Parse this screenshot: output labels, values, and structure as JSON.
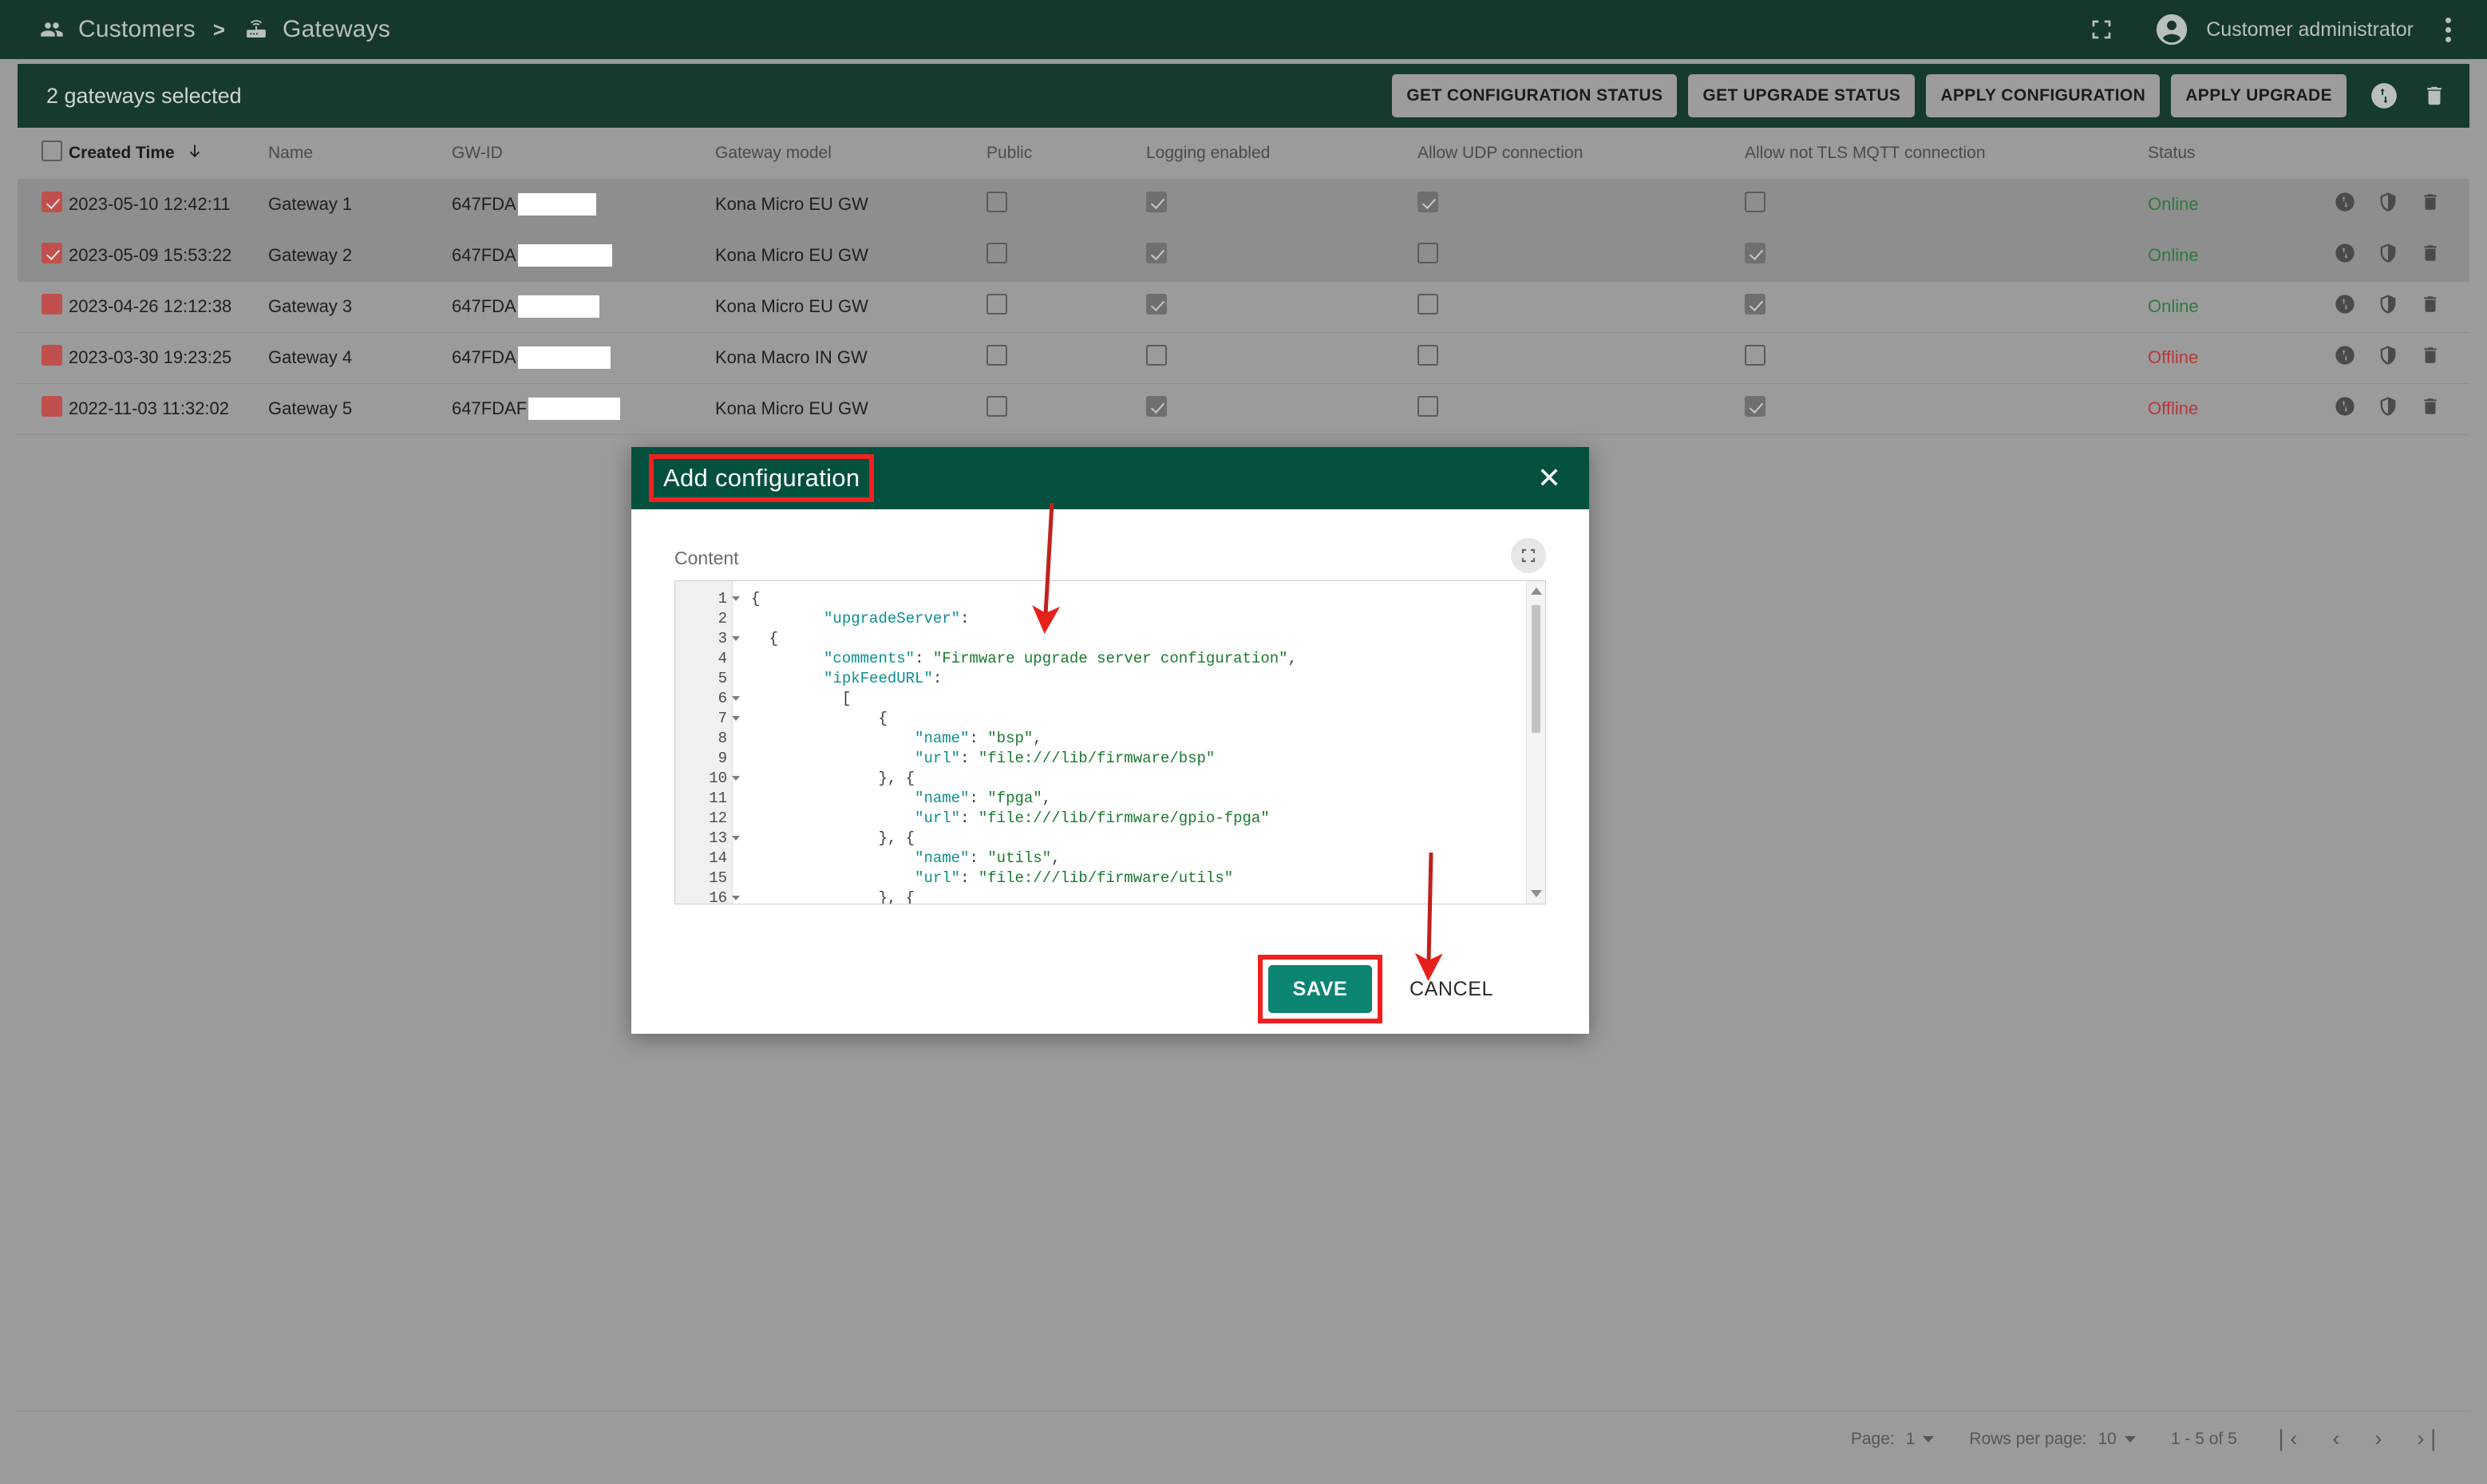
{
  "topbar": {
    "breadcrumb": [
      {
        "label": "Customers",
        "icon": "people-icon"
      },
      {
        "label": "Gateways",
        "icon": "router-wifi-icon"
      }
    ],
    "separator": ">",
    "user_name": "Customer administrator",
    "fullscreen_icon": "fullscreen-icon",
    "avatar_icon": "account-circle-icon",
    "menu_icon": "kebab-menu-icon"
  },
  "selection_toolbar": {
    "label": "2 gateways selected",
    "buttons": [
      "GET CONFIGURATION STATUS",
      "GET UPGRADE STATUS",
      "APPLY CONFIGURATION",
      "APPLY UPGRADE"
    ],
    "upgrade_icon": "up-down-arrows-icon",
    "delete_icon": "trash-icon"
  },
  "table": {
    "columns": [
      "Created Time",
      "Name",
      "GW-ID",
      "Gateway model",
      "Public",
      "Logging enabled",
      "Allow UDP connection",
      "Allow not TLS MQTT connection",
      "Status"
    ],
    "sort_column": "Created Time",
    "sort_direction": "desc",
    "rows": [
      {
        "selected": true,
        "created_time": "2023-05-10 12:42:11",
        "name": "Gateway 1",
        "gw_id_prefix": "647FDA",
        "gw_id_redacted_width": 98,
        "model": "Kona Micro EU GW",
        "public": false,
        "logging_enabled": true,
        "allow_udp": true,
        "allow_not_tls_mqtt": false,
        "status": "Online"
      },
      {
        "selected": true,
        "created_time": "2023-05-09 15:53:22",
        "name": "Gateway 2",
        "gw_id_prefix": "647FDA",
        "gw_id_redacted_width": 118,
        "model": "Kona Micro EU GW",
        "public": false,
        "logging_enabled": true,
        "allow_udp": false,
        "allow_not_tls_mqtt": true,
        "status": "Online"
      },
      {
        "selected": false,
        "created_time": "2023-04-26 12:12:38",
        "name": "Gateway 3",
        "gw_id_prefix": "647FDA",
        "gw_id_redacted_width": 102,
        "model": "Kona Micro EU GW",
        "public": false,
        "logging_enabled": true,
        "allow_udp": false,
        "allow_not_tls_mqtt": true,
        "status": "Online"
      },
      {
        "selected": false,
        "created_time": "2023-03-30 19:23:25",
        "name": "Gateway 4",
        "gw_id_prefix": "647FDA",
        "gw_id_redacted_width": 116,
        "model": "Kona Macro IN GW",
        "public": false,
        "logging_enabled": false,
        "allow_udp": false,
        "allow_not_tls_mqtt": false,
        "status": "Offline"
      },
      {
        "selected": false,
        "created_time": "2022-11-03 11:32:02",
        "name": "Gateway 5",
        "gw_id_prefix": "647FDAF",
        "gw_id_redacted_width": 115,
        "model": "Kona Micro EU GW",
        "public": false,
        "logging_enabled": true,
        "allow_udp": false,
        "allow_not_tls_mqtt": true,
        "status": "Offline"
      }
    ],
    "row_action_icons": [
      "upgrade-icon",
      "shield-icon",
      "trash-icon"
    ]
  },
  "pagination": {
    "page_label": "Page:",
    "page_value": "1",
    "rows_label": "Rows per page:",
    "rows_value": "10",
    "range": "1 - 5 of 5",
    "first_icon": "first-page-icon",
    "prev_icon": "prev-page-icon",
    "next_icon": "next-page-icon",
    "last_icon": "last-page-icon"
  },
  "modal": {
    "title": "Add configuration",
    "close_icon": "close-icon",
    "content_label": "Content",
    "expand_icon": "fullscreen-expand-icon",
    "save_label": "SAVE",
    "cancel_label": "CANCEL",
    "editor": {
      "lines": [
        {
          "n": "1",
          "fold": true,
          "indent": 0,
          "tokens": [
            {
              "t": "pun",
              "v": "{"
            }
          ]
        },
        {
          "n": "2",
          "fold": false,
          "indent": 4,
          "tokens": [
            {
              "t": "key",
              "v": "\"upgradeServer\""
            },
            {
              "t": "pun",
              "v": ":"
            }
          ]
        },
        {
          "n": "3",
          "fold": true,
          "indent": 1,
          "tokens": [
            {
              "t": "pun",
              "v": "{"
            }
          ]
        },
        {
          "n": "4",
          "fold": false,
          "indent": 4,
          "tokens": [
            {
              "t": "key",
              "v": "\"comments\""
            },
            {
              "t": "pun",
              "v": ": "
            },
            {
              "t": "str",
              "v": "\"Firmware upgrade server configuration\""
            },
            {
              "t": "pun",
              "v": ","
            }
          ]
        },
        {
          "n": "5",
          "fold": false,
          "indent": 4,
          "tokens": [
            {
              "t": "key",
              "v": "\"ipkFeedURL\""
            },
            {
              "t": "pun",
              "v": ":"
            }
          ]
        },
        {
          "n": "6",
          "fold": true,
          "indent": 5,
          "tokens": [
            {
              "t": "pun",
              "v": "["
            }
          ]
        },
        {
          "n": "7",
          "fold": true,
          "indent": 7,
          "tokens": [
            {
              "t": "pun",
              "v": "{"
            }
          ]
        },
        {
          "n": "8",
          "fold": false,
          "indent": 9,
          "tokens": [
            {
              "t": "key",
              "v": "\"name\""
            },
            {
              "t": "pun",
              "v": ": "
            },
            {
              "t": "str",
              "v": "\"bsp\""
            },
            {
              "t": "pun",
              "v": ","
            }
          ]
        },
        {
          "n": "9",
          "fold": false,
          "indent": 9,
          "tokens": [
            {
              "t": "key",
              "v": "\"url\""
            },
            {
              "t": "pun",
              "v": ": "
            },
            {
              "t": "str",
              "v": "\"file:///lib/firmware/bsp\""
            }
          ]
        },
        {
          "n": "10",
          "fold": true,
          "indent": 7,
          "tokens": [
            {
              "t": "pun",
              "v": "}, {"
            }
          ]
        },
        {
          "n": "11",
          "fold": false,
          "indent": 9,
          "tokens": [
            {
              "t": "key",
              "v": "\"name\""
            },
            {
              "t": "pun",
              "v": ": "
            },
            {
              "t": "str",
              "v": "\"fpga\""
            },
            {
              "t": "pun",
              "v": ","
            }
          ]
        },
        {
          "n": "12",
          "fold": false,
          "indent": 9,
          "tokens": [
            {
              "t": "key",
              "v": "\"url\""
            },
            {
              "t": "pun",
              "v": ": "
            },
            {
              "t": "str",
              "v": "\"file:///lib/firmware/gpio-fpga\""
            }
          ]
        },
        {
          "n": "13",
          "fold": true,
          "indent": 7,
          "tokens": [
            {
              "t": "pun",
              "v": "}, {"
            }
          ]
        },
        {
          "n": "14",
          "fold": false,
          "indent": 9,
          "tokens": [
            {
              "t": "key",
              "v": "\"name\""
            },
            {
              "t": "pun",
              "v": ": "
            },
            {
              "t": "str",
              "v": "\"utils\""
            },
            {
              "t": "pun",
              "v": ","
            }
          ]
        },
        {
          "n": "15",
          "fold": false,
          "indent": 9,
          "tokens": [
            {
              "t": "key",
              "v": "\"url\""
            },
            {
              "t": "pun",
              "v": ": "
            },
            {
              "t": "str",
              "v": "\"file:///lib/firmware/utils\""
            }
          ]
        },
        {
          "n": "16",
          "fold": true,
          "indent": 7,
          "tokens": [
            {
              "t": "pun",
              "v": "}, {"
            }
          ]
        }
      ]
    }
  },
  "annotations": {
    "highlight_color": "#f41f1f",
    "arrow_color": "#e8201c",
    "highlighted": [
      "modal-title",
      "save-button"
    ]
  },
  "colors": {
    "topbar": "#16372e",
    "toolbar": "#163a30",
    "modal_header": "#04503f",
    "save_button": "#0b8471",
    "page_bg": "#9b9b9b",
    "status_online": "#2f7a3d",
    "status_offline": "#b4383b"
  }
}
